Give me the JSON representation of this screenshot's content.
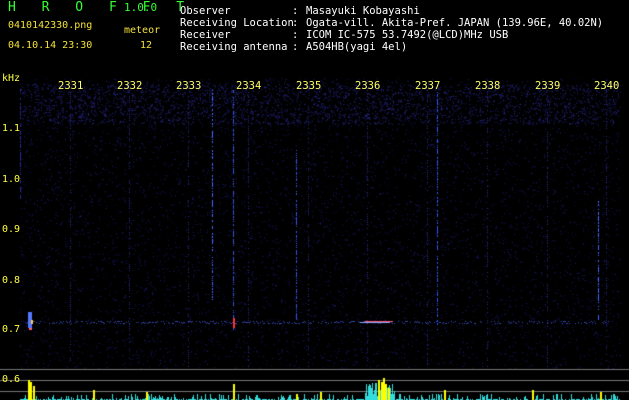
{
  "header": {
    "app_title": "H R O F F T",
    "app_version": "1.0.0",
    "filename": "0410142330.png",
    "meteor_label": "meteor",
    "datetime": "04.10.14 23:30",
    "meteor_count": "12"
  },
  "info": [
    {
      "label": "Observer",
      "sep": ":",
      "value": "Masayuki Kobayashi"
    },
    {
      "label": "Receiving Location",
      "sep": ":",
      "value": "Ogata-vill. Akita-Pref. JAPAN (139.96E, 40.02N)"
    },
    {
      "label": "Receiver",
      "sep": ":",
      "value": "ICOM IC-575 53.7492(@LCD)MHz USB"
    },
    {
      "label": "Receiving antenna",
      "sep": ":",
      "value": "A504HB(yagi 4el)"
    }
  ],
  "axis": {
    "y_unit": "kHz",
    "x_ticks": [
      "2331",
      "2332",
      "2333",
      "2334",
      "2335",
      "2336",
      "2337",
      "2338",
      "2339",
      "2340"
    ],
    "y_ticks": [
      "1.1",
      "1.0",
      "0.9",
      "0.8",
      "0.7",
      "0.6"
    ]
  },
  "colors": {
    "background": "#000000",
    "noise": "#1a1a66",
    "title_green": "#33ff33",
    "label_yellow": "#ffff44",
    "bar_cyan": "#33dddd",
    "bar_yellow": "#ffff00"
  }
}
